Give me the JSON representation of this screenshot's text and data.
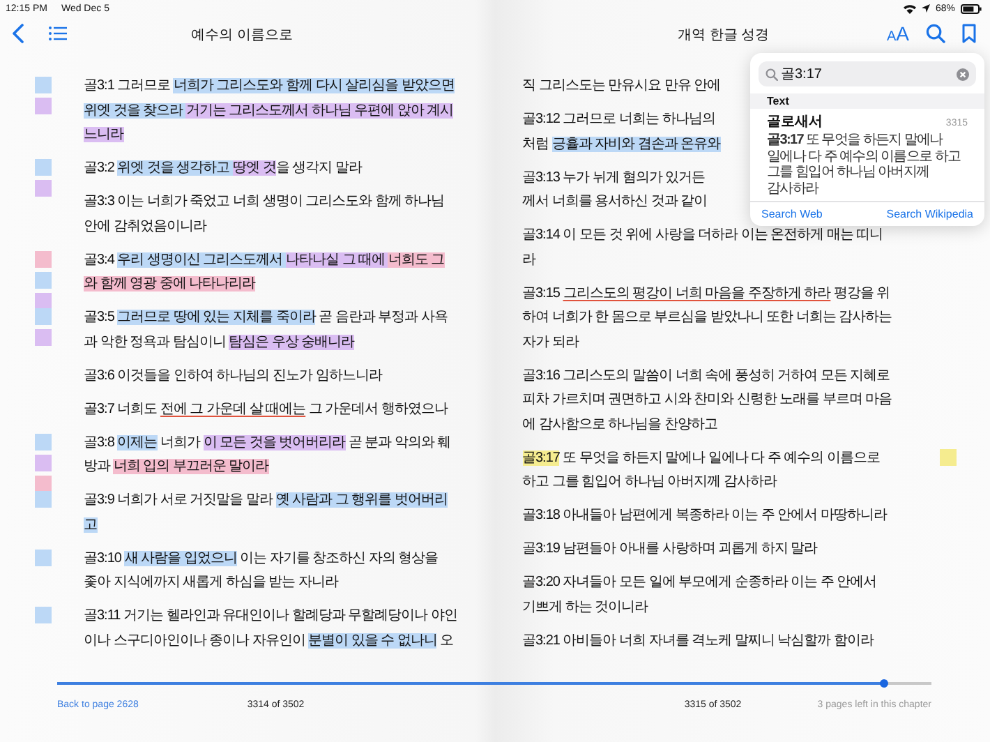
{
  "status_bar": {
    "time": "12:15 PM",
    "date": "Wed Dec 5",
    "battery": "68%"
  },
  "toolbar": {
    "left_title": "예수의 이름으로",
    "right_title": "개역 한글 성경",
    "font_button": "AA"
  },
  "pages": [
    {
      "verses": [
        {
          "marks": [
            {
              "color": "#bcd8f6"
            },
            {
              "color": "#dabdf2"
            }
          ],
          "lines": [
            [
              {
                "text": "골3:1 그러므로 "
              },
              {
                "text": "너희가 그리스도와 함께 다시 살리심을 받았으면",
                "color": "#bcd8f6"
              }
            ],
            [
              {
                "text": "위엣 것을 찾으라 ",
                "color": "#bcd8f6"
              },
              {
                "text": "거기는 그리스도께서 하나님 우편에 앉아 계시",
                "color": "#dabdf2"
              }
            ],
            [
              {
                "text": "느니라",
                "color": "#dabdf2"
              }
            ]
          ]
        },
        {
          "marks": [
            {
              "color": "#bcd8f6"
            },
            {
              "color": "#dabdf2"
            }
          ],
          "lines": [
            [
              {
                "text": "골3:2 "
              },
              {
                "text": "위엣 것을 생각하고 ",
                "color": "#bcd8f6"
              },
              {
                "text": "땅엣 것",
                "color": "#dabdf2"
              },
              {
                "text": "을 생각지 말라"
              }
            ]
          ]
        },
        {
          "lines": [
            [
              {
                "text": "골3:3 이는 너희가 죽었고 너희 생명이 그리스도와 함께 하나님"
              }
            ],
            [
              {
                "text": "안에 감취었음이니라"
              }
            ]
          ]
        },
        {
          "marks": [
            {
              "color": "#f4bccd"
            },
            {
              "color": "#bcd8f6"
            },
            {
              "color": "#dabdf2"
            }
          ],
          "lines": [
            [
              {
                "text": "골3:4 "
              },
              {
                "text": "우리 생명이신 그리스도께서 ",
                "color": "#bcd8f6"
              },
              {
                "text": "나타나실 그 때에 ",
                "color": "#dabdf2"
              },
              {
                "text": "너희도 그",
                "color": "#f4bccd"
              }
            ],
            [
              {
                "text": "와 함께 영광 중에 나타나리라",
                "color": "#f4bccd"
              }
            ]
          ]
        },
        {
          "marks": [
            {
              "color": "#bcd8f6"
            },
            {
              "color": "#dabdf2"
            }
          ],
          "lines": [
            [
              {
                "text": "골3:5 "
              },
              {
                "text": "그러므로 땅에 있는 지체를 죽이라",
                "color": "#bcd8f6"
              },
              {
                "text": " 곧 음란과 부정과 사욕"
              }
            ],
            [
              {
                "text": "과 악한 정욕과 탐심이니 "
              },
              {
                "text": "탐심은 우상 숭배니라",
                "color": "#dabdf2"
              }
            ]
          ]
        },
        {
          "lines": [
            [
              {
                "text": "골3:6 이것들을 인하여 하나님의 진노가 임하느니라"
              }
            ]
          ]
        },
        {
          "lines": [
            [
              {
                "text": "골3:7 너희도 "
              },
              {
                "text": "전에 그 가운데 살 때에는",
                "kind": "underline"
              },
              {
                "text": " 그 가운데서 행하였으나"
              }
            ]
          ]
        },
        {
          "marks": [
            {
              "color": "#bcd8f6"
            },
            {
              "color": "#dabdf2"
            },
            {
              "color": "#f4bccd"
            }
          ],
          "lines": [
            [
              {
                "text": "골3:8 "
              },
              {
                "text": "이제는",
                "color": "#bcd8f6"
              },
              {
                "text": " 너희가 "
              },
              {
                "text": "이 모든 것을 벗어버리라",
                "color": "#dabdf2"
              },
              {
                "text": " 곧 분과 악의와 훼"
              }
            ],
            [
              {
                "text": "방과 "
              },
              {
                "text": "너희 입의 부끄러운 말이라",
                "color": "#f4bccd"
              }
            ]
          ]
        },
        {
          "marks": [
            {
              "color": "#bcd8f6"
            }
          ],
          "lines": [
            [
              {
                "text": "골3:9 너희가 서로 거짓말을 말라 "
              },
              {
                "text": "옛 사람과 그 행위를 벗어버리",
                "color": "#bcd8f6"
              }
            ],
            [
              {
                "text": "고",
                "color": "#bcd8f6"
              }
            ]
          ]
        },
        {
          "marks": [
            {
              "color": "#bcd8f6"
            }
          ],
          "lines": [
            [
              {
                "text": "골3:10 "
              },
              {
                "text": "새 사람을 입었으니",
                "color": "#bcd8f6"
              },
              {
                "text": " 이는 자기를 창조하신 자의 형상을"
              }
            ],
            [
              {
                "text": "좇아 지식에까지 새롭게 하심을 받는 자니라"
              }
            ]
          ]
        },
        {
          "marks": [
            {
              "color": "#bcd8f6"
            }
          ],
          "lines": [
            [
              {
                "text": "골3:11 거기는 헬라인과 유대인이나 할례당과 무할례당이나 야인"
              }
            ],
            [
              {
                "text": "이나 스구디아인이나 종이나 자유인이 "
              },
              {
                "text": "분별이 있을 수 없나니",
                "color": "#bcd8f6"
              },
              {
                "text": " 오"
              }
            ]
          ]
        }
      ]
    },
    {
      "verses": [
        {
          "lines": [
            [
              {
                "text": "직 그리스도는 만유시요 만유 안에"
              }
            ]
          ]
        },
        {
          "lines": [
            [
              {
                "text": "골3:12 그러므로 너희는 하나님의"
              }
            ],
            [
              {
                "text": "처럼 "
              },
              {
                "text": "긍휼과 자비와 겸손과 온유와",
                "color": "#bcd8f6"
              }
            ]
          ]
        },
        {
          "lines": [
            [
              {
                "text": "골3:13 누가 뉘게 혐의가 있거든"
              }
            ],
            [
              {
                "text": "께서 너희를 용서하신 것과 같이"
              }
            ]
          ]
        },
        {
          "lines": [
            [
              {
                "text": "골3:14 이 모든 것 위에 사랑을 더하라 이는 온전하게 매는 띠니"
              }
            ],
            [
              {
                "text": "라"
              }
            ]
          ]
        },
        {
          "lines": [
            [
              {
                "text": "골3:15 "
              },
              {
                "text": "그리스도의 평강이 너희 마음을 주장하게 하라",
                "kind": "underline"
              },
              {
                "text": " 평강을 위"
              }
            ],
            [
              {
                "text": "하여 너희가 한 몸으로 부르심을 받았나니 또한 너희는 감사하는"
              }
            ],
            [
              {
                "text": "자가 되라"
              }
            ]
          ]
        },
        {
          "lines": [
            [
              {
                "text": "골3:16 그리스도의 말씀이 너희 속에 풍성히 거하여 모든 지혜로"
              }
            ],
            [
              {
                "text": "피차 가르치며 권면하고 시와 찬미와 신령한 노래를 부르며 마음"
              }
            ],
            [
              {
                "text": "에 감사함으로 하나님을 찬양하고"
              }
            ]
          ]
        },
        {
          "marks": [
            {
              "color": "#f5ec8f"
            }
          ],
          "lines": [
            [
              {
                "text": "골3:17",
                "color": "#f5ec8f"
              },
              {
                "text": " 또 무엇을 하든지 말에나 일에나 다 주 예수의 이름으로"
              }
            ],
            [
              {
                "text": "하고 그를 힘입어 하나님 아버지께 감사하라"
              }
            ]
          ]
        },
        {
          "lines": [
            [
              {
                "text": "골3:18 아내들아 남편에게 복종하라 이는 주 안에서 마땅하니라"
              }
            ]
          ]
        },
        {
          "lines": [
            [
              {
                "text": "골3:19 남편들아 아내를 사랑하며 괴롭게 하지 말라"
              }
            ]
          ]
        },
        {
          "lines": [
            [
              {
                "text": "골3:20 자녀들아 모든 일에 부모에게 순종하라 이는 주 안에서"
              }
            ],
            [
              {
                "text": "기쁘게 하는 것이니라"
              }
            ]
          ]
        },
        {
          "lines": [
            [
              {
                "text": "골3:21 아비들아 너희 자녀를 격노케 말찌니 낙심할까 함이라"
              }
            ]
          ]
        }
      ]
    }
  ],
  "progress": {
    "level": 0.946
  },
  "footer": {
    "back_link": "Back to page 2628",
    "left_page": "3314 of 3502",
    "right_page": "3315 of 3502",
    "remaining": "3 pages left in this chapter"
  },
  "search_popover": {
    "query": "골3:17",
    "section": "Text",
    "results": [
      {
        "title": "골로새서",
        "page": "3315",
        "snippet": "**골3:17** 또 무엇을 하든지 말에나 일에나 다 주 예수의 이름으로 하고 그를 힘입어 하나님 아버지께 감사하라"
      }
    ],
    "links": [
      "Search Web",
      "Search Wikipedia"
    ]
  }
}
